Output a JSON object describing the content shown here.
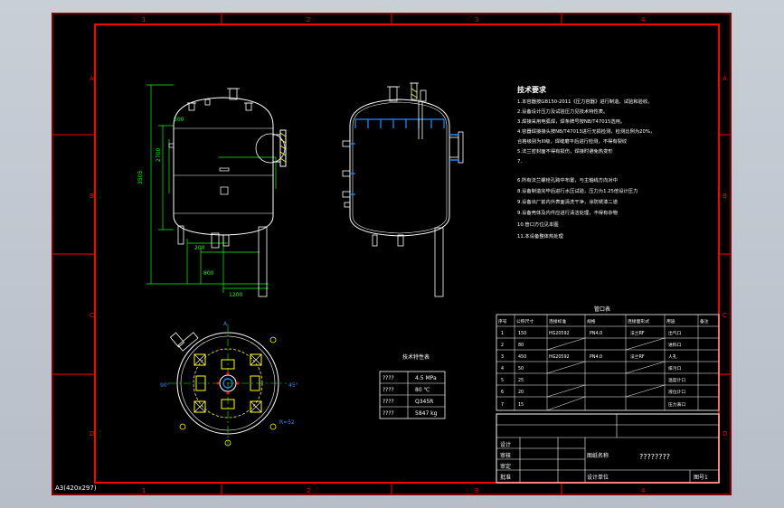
{
  "colors": {
    "background": "#000000",
    "frame": "#ff0000",
    "outline": "#ffffff",
    "dimension": "#00ff00",
    "nozzle": "#1e90ff",
    "hatch": "#ffff00",
    "text": "#ffffff"
  },
  "frame": {
    "col_labels": [
      "1",
      "2",
      "3",
      "4"
    ],
    "row_labels": [
      "A",
      "B",
      "C",
      "D"
    ],
    "sheet_size": "A3(420x297)"
  },
  "notes": {
    "title": "技术要求",
    "lines": [
      "1.本容器按GB150-2011《压力容器》进行制造、试验和验收。",
      "2.设备设计压力及试验压力见技术特性表。",
      "3.焊接采用电弧焊，焊条牌号按NB/T47015选用。",
      "4.容器焊接接头按NB/T47013进行无损检测，检测比例为20%，",
      "合格级别为III级，焊缝磨平后进行检测，不得有裂纹",
      "5.法兰密封面不得有损伤，焊接时避免热变形",
      "7.",
      "6.所有法兰螺栓孔跨中布置，与主轴线方向对中",
      "8.设备制造完毕后进行水压试验，压力为1.25倍设计压力",
      "9.设备出厂前内外表面清洗干净，涂防锈漆二道",
      "9.设备壳体及内件应进行清洁处理，不得有杂物",
      "10.管口方位见本图",
      "11.本设备整体热处理"
    ]
  },
  "spec_table": {
    "title": "技术特性表",
    "rows": [
      {
        "label": "????",
        "value": "4.5 MPa"
      },
      {
        "label": "????",
        "value": "80 ℃"
      },
      {
        "label": "????",
        "value": "Q345R"
      },
      {
        "label": "????",
        "value": "5847 kg"
      }
    ]
  },
  "nozzle_table": {
    "title": "管口表",
    "header": [
      "序号",
      "公称尺寸",
      "连接标准",
      "规格",
      "连接面形式",
      "用途",
      "备注"
    ],
    "rows": [
      [
        "1",
        "150",
        "HG20592",
        "PN4.0",
        "法兰RF",
        "出气口",
        ""
      ],
      [
        "2",
        "80",
        "",
        "",
        "",
        "进料口",
        ""
      ],
      [
        "3",
        "450",
        "HG20592",
        "PN4.0",
        "法兰RF",
        "人孔",
        ""
      ],
      [
        "4",
        "50",
        "",
        "",
        "",
        "排污口",
        ""
      ],
      [
        "5",
        "25",
        "",
        "",
        "",
        "温度计口",
        ""
      ],
      [
        "6",
        "20",
        "",
        "",
        "",
        "液位计口",
        ""
      ],
      [
        "7",
        "15",
        "",
        "",
        "",
        "压力表口",
        ""
      ]
    ]
  },
  "title_block": {
    "drawing_title": "????????",
    "company": "设计单位",
    "scale_label": "比例",
    "scale_value": "1:10",
    "sheet": "图号1",
    "roles": [
      "设计",
      "审核",
      "审定",
      "批准"
    ],
    "check_label": "图纸名称",
    "material_label": "材料"
  },
  "dimensions": {
    "height_left": "3505",
    "height_inner": "2700",
    "upper": "500",
    "lower": "200",
    "bottom_a": "1200",
    "bottom_b": "800",
    "radius": "R=52",
    "angle": "90°",
    "angle2": "45°",
    "nozzle_tag": "A"
  }
}
